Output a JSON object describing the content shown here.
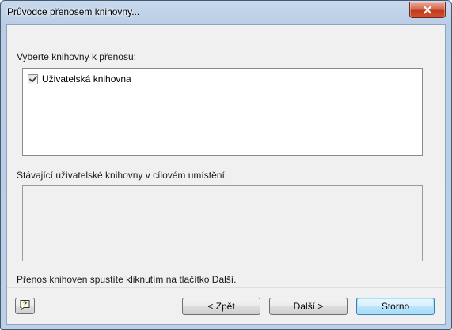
{
  "window": {
    "title": "Průvodce přenosem knihovny..."
  },
  "select_section": {
    "label": "Vyberte knihovny k přenosu:",
    "items": [
      {
        "label": "Uživatelská knihovna",
        "checked": true
      }
    ]
  },
  "existing_section": {
    "label": "Stávající uživatelské knihovny v cílovém umístění:",
    "items": []
  },
  "instruction": "Přenos knihoven spustíte kliknutím na tlačítko Další.",
  "buttons": {
    "back": "< Zpět",
    "next": "Další >",
    "cancel": "Storno"
  },
  "icons": {
    "close": "close-icon",
    "help": "help-icon",
    "check": "checkmark-icon"
  },
  "colors": {
    "titlebar": "#c7d9ee",
    "close_button": "#c0391d",
    "dialog_background": "#f0f0f0",
    "default_button_border": "#3c7fb1"
  }
}
